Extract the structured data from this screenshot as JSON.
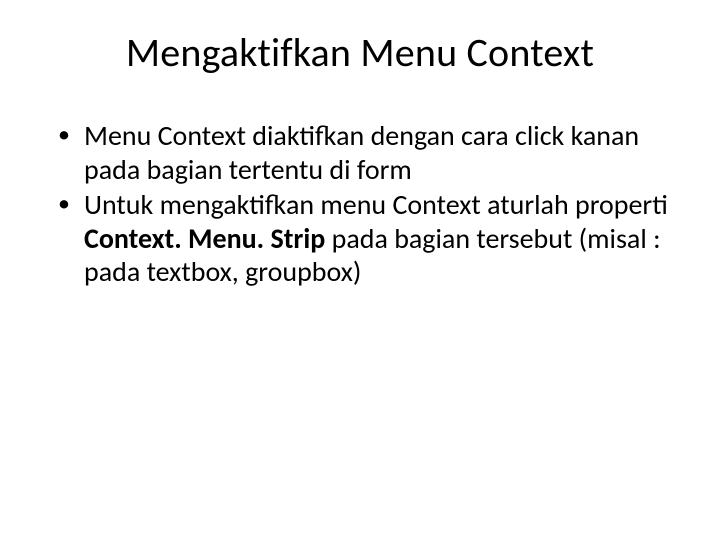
{
  "slide": {
    "title": "Mengaktifkan Menu Context",
    "bullets": [
      {
        "text": "Menu Context diaktifkan dengan cara click kanan pada bagian tertentu di form"
      },
      {
        "prefix": "Untuk mengaktifkan menu Context aturlah properti ",
        "bold": "Context. Menu. Strip",
        "suffix": " pada bagian tersebut (misal : pada textbox, groupbox)"
      }
    ]
  }
}
